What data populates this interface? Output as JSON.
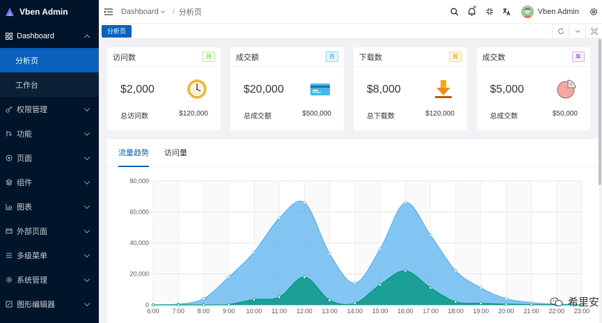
{
  "app": {
    "title": "Vben Admin"
  },
  "sidebar": {
    "items": [
      {
        "label": "Dashboard",
        "icon": "grid-icon",
        "expanded": true
      },
      {
        "label": "分析页",
        "active": true
      },
      {
        "label": "工作台"
      },
      {
        "label": "权限管理",
        "icon": "key-icon"
      },
      {
        "label": "功能",
        "icon": "function-icon"
      },
      {
        "label": "页面",
        "icon": "page-icon"
      },
      {
        "label": "组件",
        "icon": "components-icon"
      },
      {
        "label": "图表",
        "icon": "chart-icon"
      },
      {
        "label": "外部页面",
        "icon": "external-icon"
      },
      {
        "label": "多级菜单",
        "icon": "menu-icon"
      },
      {
        "label": "系统管理",
        "icon": "settings-icon"
      },
      {
        "label": "图形编辑器",
        "icon": "editor-icon"
      }
    ]
  },
  "header": {
    "breadcrumb": [
      "Dashboard",
      "分析页"
    ],
    "username": "Vben Admin",
    "icons": [
      "search-icon",
      "bell-icon",
      "fullscreen-icon",
      "translate-icon",
      "avatar",
      "settings-icon"
    ]
  },
  "tabs": {
    "active_label": "分析页"
  },
  "cards": [
    {
      "title": "访问数",
      "tag": "月",
      "tag_color": "green",
      "value": "$2,000",
      "foot_label": "总访问数",
      "foot_value": "$120,000",
      "icon": "clock-icon"
    },
    {
      "title": "成交额",
      "tag": "月",
      "tag_color": "blue",
      "value": "$20,000",
      "foot_label": "总成交额",
      "foot_value": "$500,000",
      "icon": "credit-card-icon"
    },
    {
      "title": "下载数",
      "tag": "周",
      "tag_color": "orange",
      "value": "$8,000",
      "foot_label": "总下载数",
      "foot_value": "$120,000",
      "icon": "download-icon"
    },
    {
      "title": "成交数",
      "tag": "年",
      "tag_color": "purple",
      "value": "$5,000",
      "foot_label": "总成交数",
      "foot_value": "$50,000",
      "icon": "pie-chart-icon"
    }
  ],
  "chart_tabs": [
    "流量趋势",
    "访问量"
  ],
  "watermark": {
    "text": "希里安"
  },
  "colors": {
    "sidebar_bg": "#001529",
    "primary": "#0960bd",
    "series_1": "#5ab1ef",
    "series_2": "#019680"
  },
  "chart_data": {
    "type": "area",
    "x": [
      "6:00",
      "7:00",
      "8:00",
      "9:00",
      "10:00",
      "11:00",
      "12:00",
      "13:00",
      "14:00",
      "15:00",
      "16:00",
      "17:00",
      "18:00",
      "19:00",
      "20:00",
      "21:00",
      "22:00",
      "23:00"
    ],
    "y_ticks": [
      "0",
      "20,000",
      "40,000",
      "60,000",
      "80,000"
    ],
    "ylim": [
      0,
      80000
    ],
    "grid": true,
    "series": [
      {
        "values": [
          0,
          500,
          4000,
          18000,
          34000,
          56000,
          66000,
          33000,
          14000,
          36000,
          66000,
          45000,
          22000,
          11000,
          4000,
          1500,
          500,
          0
        ]
      },
      {
        "values": [
          0,
          0,
          0,
          300,
          3500,
          5000,
          18000,
          3000,
          1000,
          13000,
          22000,
          11000,
          2000,
          1000,
          500,
          200,
          0,
          0
        ]
      }
    ]
  }
}
